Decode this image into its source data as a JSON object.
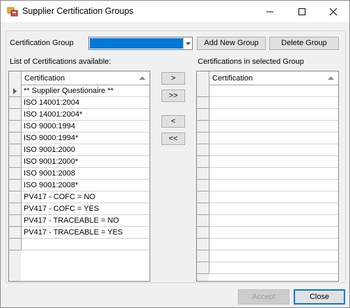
{
  "window": {
    "title": "Supplier Certification Groups",
    "icon": "app-window-icon"
  },
  "group_selector": {
    "label": "Certification Group",
    "selected_value": "",
    "add_button": "Add New Group",
    "delete_button": "Delete Group"
  },
  "available": {
    "label": "List of Certifications available:",
    "column_header": "Certification",
    "rows": [
      "** Supplier Questionaire **",
      "ISO 14001:2004",
      "ISO 14001:2004*",
      "ISO 9000:1994",
      "ISO 9000:1994*",
      "ISO 9001:2000",
      "ISO 9001:2000*",
      "ISO 9001:2008",
      "ISO 9001:2008*",
      "PV417 - COFC = NO",
      "PV417 - COFC = YES",
      "PV417 - TRACEABLE = NO",
      "PV417 - TRACEABLE = YES"
    ],
    "current_row_index": 0
  },
  "transfer": {
    "add_one": ">",
    "add_all": ">>",
    "remove_one": "<",
    "remove_all": "<<"
  },
  "selected": {
    "label": "Certifications in selected Group",
    "column_header": "Certification",
    "rows": []
  },
  "footer": {
    "accept_button": "Accept",
    "close_button": "Close"
  },
  "colors": {
    "selection": "#0078d7",
    "dialog_bg": "#f0f0f0",
    "button_bg": "#e1e1e1"
  }
}
